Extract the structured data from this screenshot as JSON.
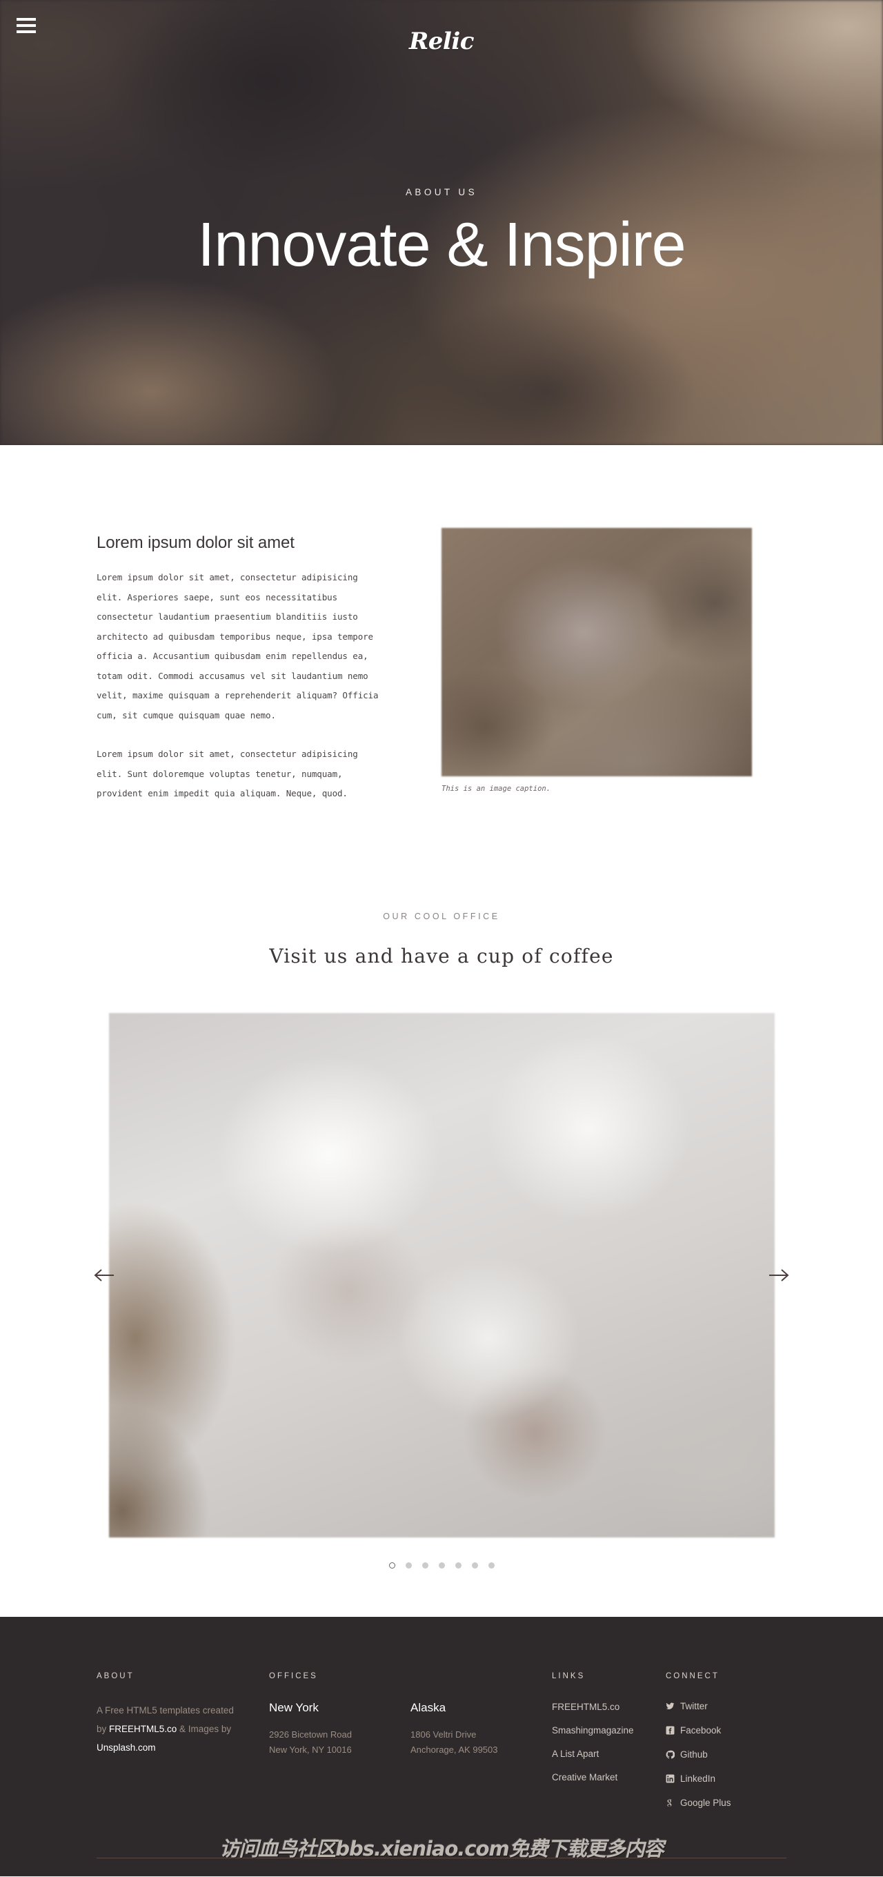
{
  "header": {
    "logo": "Relic",
    "menu_icon": "hamburger-icon"
  },
  "hero": {
    "eyebrow": "ABOUT US",
    "title": "Innovate & Inspire"
  },
  "about": {
    "heading": "Lorem ipsum dolor sit amet",
    "paragraph1": "Lorem ipsum dolor sit amet, consectetur adipisicing elit. Asperiores saepe, sunt eos necessitatibus consectetur laudantium praesentium blanditiis iusto architecto ad quibusdam temporibus neque, ipsa tempore officia a. Accusantium quibusdam enim repellendus ea, totam odit. Commodi accusamus vel sit laudantium nemo velit, maxime quisquam a reprehenderit aliquam? Officia cum, sit cumque quisquam quae nemo.",
    "paragraph2": "Lorem ipsum dolor sit amet, consectetur adipisicing elit. Sunt doloremque voluptas tenetur, numquam, provident enim impedit quia aliquam. Neque, quod.",
    "image_caption": "This is an image caption."
  },
  "office": {
    "eyebrow": "OUR COOL OFFICE",
    "heading": "Visit us and have a cup of coffee"
  },
  "carousel": {
    "prev_label": "Previous slide",
    "next_label": "Next slide",
    "dots": [
      {
        "active": true
      },
      {
        "active": false
      },
      {
        "active": false
      },
      {
        "active": false
      },
      {
        "active": false
      },
      {
        "active": false
      },
      {
        "active": false
      }
    ]
  },
  "footer": {
    "about": {
      "heading": "ABOUT",
      "line1": "A Free HTML5 templates created",
      "line2_pre": "by ",
      "line2_link": "FREEHTML5.co",
      "line2_post": " & Images by",
      "line3": "Unsplash.com"
    },
    "offices": {
      "heading": "OFFICES",
      "items": [
        {
          "city": "New York",
          "address1": "2926 Bicetown Road",
          "address2": "New York, NY 10016"
        },
        {
          "city": "Alaska",
          "address1": "1806 Veltri Drive",
          "address2": "Anchorage, AK 99503"
        }
      ]
    },
    "links": {
      "heading": "LINKS",
      "items": [
        "FREEHTML5.co",
        "Smashingmagazine",
        "A List Apart",
        "Creative Market"
      ]
    },
    "connect": {
      "heading": "CONNECT",
      "items": [
        {
          "label": "Twitter",
          "icon": "twitter-icon"
        },
        {
          "label": "Facebook",
          "icon": "facebook-icon"
        },
        {
          "label": "Github",
          "icon": "github-icon"
        },
        {
          "label": "LinkedIn",
          "icon": "linkedin-icon"
        },
        {
          "label": "Google Plus",
          "icon": "google-plus-icon"
        }
      ]
    }
  },
  "watermark": {
    "text": "访问血鸟社区bbs.xieniao.com免费下载更多内容"
  },
  "colors": {
    "hero_dark": "#342f31",
    "hero_tan": "#a08a72",
    "footer_bg": "#2e2a2c",
    "footer_muted": "#9b8d81",
    "footer_divider": "#5a4a41",
    "body_text": "#4a4548"
  }
}
